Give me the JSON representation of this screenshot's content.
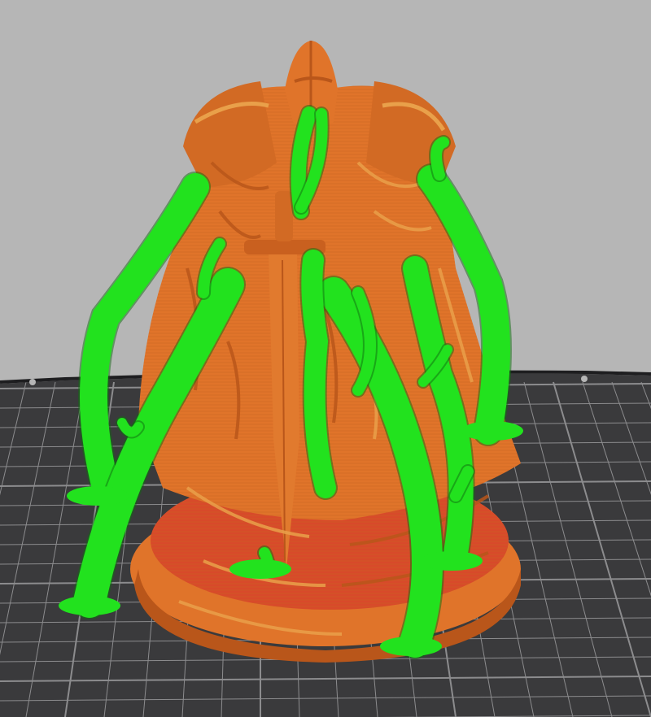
{
  "viewport": {
    "background_top": "#bebebe",
    "background_bottom": "#a7a7a7"
  },
  "build_plate": {
    "color": "#3a3a3c",
    "grid_color": "#8c8c8e",
    "edge_color": "#1e1e20"
  },
  "model": {
    "color": "#e0742a",
    "shadow_color": "#b9561a",
    "highlight_color": "#e9a04a",
    "base_color": "#d84a2a",
    "base_detail_color": "#e98a34"
  },
  "supports": {
    "color": "#22e21e",
    "dark_color": "#0f6b10"
  }
}
